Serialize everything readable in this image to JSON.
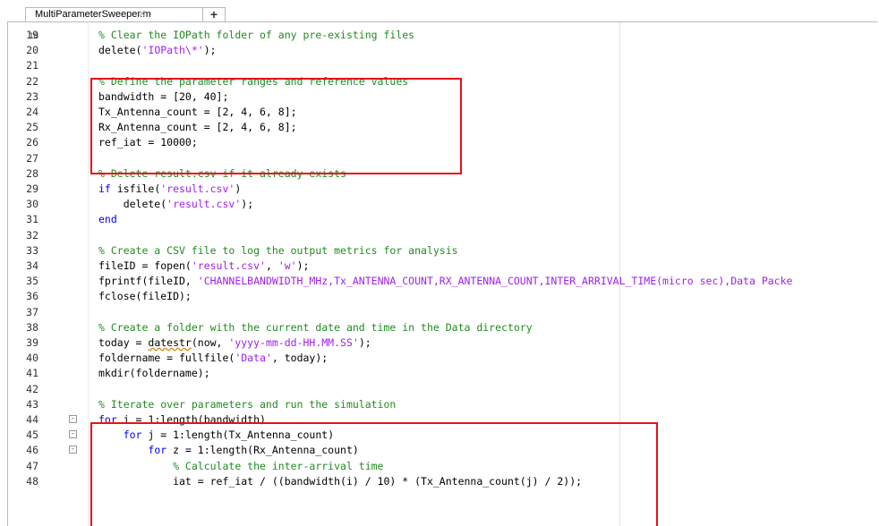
{
  "tab": {
    "filename": "MultiParameterSweeper.m",
    "close_glyph": "✕",
    "new_tab": "+"
  },
  "first_partial_line": "18",
  "lines": [
    {
      "n": "19",
      "parts": [
        {
          "t": "% Clear the IOPath folder of any pre-existing files",
          "c": "cm"
        }
      ]
    },
    {
      "n": "20",
      "parts": [
        {
          "t": "delete(",
          "c": ""
        },
        {
          "t": "'IOPath\\*'",
          "c": "st"
        },
        {
          "t": ");",
          "c": ""
        }
      ]
    },
    {
      "n": "21",
      "parts": []
    },
    {
      "n": "22",
      "parts": [
        {
          "t": "% Define the parameter ranges and reference values",
          "c": "cm"
        }
      ]
    },
    {
      "n": "23",
      "parts": [
        {
          "t": "bandwidth = [20, 40];",
          "c": ""
        }
      ]
    },
    {
      "n": "24",
      "parts": [
        {
          "t": "Tx_Antenna_count = [2, 4, 6, 8];",
          "c": ""
        }
      ]
    },
    {
      "n": "25",
      "parts": [
        {
          "t": "Rx_Antenna_count = [2, 4, 6, 8];",
          "c": ""
        }
      ]
    },
    {
      "n": "26",
      "parts": [
        {
          "t": "ref_iat = 10000;",
          "c": ""
        }
      ]
    },
    {
      "n": "27",
      "parts": []
    },
    {
      "n": "28",
      "parts": [
        {
          "t": "% Delete result.csv if it already exists",
          "c": "cm"
        }
      ]
    },
    {
      "n": "29",
      "parts": [
        {
          "t": "if",
          "c": "kw"
        },
        {
          "t": " isfile(",
          "c": ""
        },
        {
          "t": "'result.csv'",
          "c": "st"
        },
        {
          "t": ")",
          "c": ""
        }
      ]
    },
    {
      "n": "30",
      "parts": [
        {
          "t": "    delete(",
          "c": ""
        },
        {
          "t": "'result.csv'",
          "c": "st"
        },
        {
          "t": ");",
          "c": ""
        }
      ]
    },
    {
      "n": "31",
      "parts": [
        {
          "t": "end",
          "c": "kw"
        }
      ]
    },
    {
      "n": "32",
      "parts": []
    },
    {
      "n": "33",
      "parts": [
        {
          "t": "% Create a CSV file to log the output metrics for analysis",
          "c": "cm"
        }
      ]
    },
    {
      "n": "34",
      "parts": [
        {
          "t": "fileID = fopen(",
          "c": ""
        },
        {
          "t": "'result.csv'",
          "c": "st"
        },
        {
          "t": ", ",
          "c": ""
        },
        {
          "t": "'w'",
          "c": "st"
        },
        {
          "t": ");",
          "c": ""
        }
      ]
    },
    {
      "n": "35",
      "parts": [
        {
          "t": "fprintf(fileID, ",
          "c": ""
        },
        {
          "t": "'CHANNELBANDWIDTH_MHz,Tx_ANTENNA_COUNT,RX_ANTENNA_COUNT,INTER_ARRIVAL_TIME(micro sec),Data Packe",
          "c": "st"
        }
      ]
    },
    {
      "n": "36",
      "parts": [
        {
          "t": "fclose(fileID);",
          "c": ""
        }
      ]
    },
    {
      "n": "37",
      "parts": []
    },
    {
      "n": "38",
      "parts": [
        {
          "t": "% Create a folder with the current date and time in the Data directory",
          "c": "cm"
        }
      ]
    },
    {
      "n": "39",
      "parts": [
        {
          "t": "today = ",
          "c": ""
        },
        {
          "t": "datestr",
          "c": "sq"
        },
        {
          "t": "(now, ",
          "c": ""
        },
        {
          "t": "'yyyy-mm-dd-HH.MM.SS'",
          "c": "st"
        },
        {
          "t": ");",
          "c": ""
        }
      ]
    },
    {
      "n": "40",
      "parts": [
        {
          "t": "foldername = fullfile(",
          "c": ""
        },
        {
          "t": "'Data'",
          "c": "st"
        },
        {
          "t": ", today);",
          "c": ""
        }
      ]
    },
    {
      "n": "41",
      "parts": [
        {
          "t": "mkdir(foldername);",
          "c": ""
        }
      ]
    },
    {
      "n": "42",
      "parts": []
    },
    {
      "n": "43",
      "parts": [
        {
          "t": "% Iterate over parameters and run the simulation",
          "c": "cm"
        }
      ]
    },
    {
      "n": "44",
      "fold": "-",
      "parts": [
        {
          "t": "for",
          "c": "kw"
        },
        {
          "t": " i = 1:length(bandwidth)",
          "c": ""
        }
      ]
    },
    {
      "n": "45",
      "fold": "-",
      "parts": [
        {
          "t": "    ",
          "c": ""
        },
        {
          "t": "for",
          "c": "kw"
        },
        {
          "t": " j = 1:length(Tx_Antenna_count)",
          "c": ""
        }
      ]
    },
    {
      "n": "46",
      "fold": "-",
      "parts": [
        {
          "t": "        ",
          "c": ""
        },
        {
          "t": "for",
          "c": "kw"
        },
        {
          "t": " z = 1:length(Rx_Antenna_count)",
          "c": ""
        }
      ]
    },
    {
      "n": "47",
      "parts": [
        {
          "t": "            % Calculate the inter-arrival time",
          "c": "cm"
        }
      ]
    },
    {
      "n": "48",
      "parts": [
        {
          "t": "            iat = ref_iat / ((bandwidth(i) / 10) * (Tx_Antenna_count(j) / 2));",
          "c": ""
        }
      ]
    }
  ]
}
